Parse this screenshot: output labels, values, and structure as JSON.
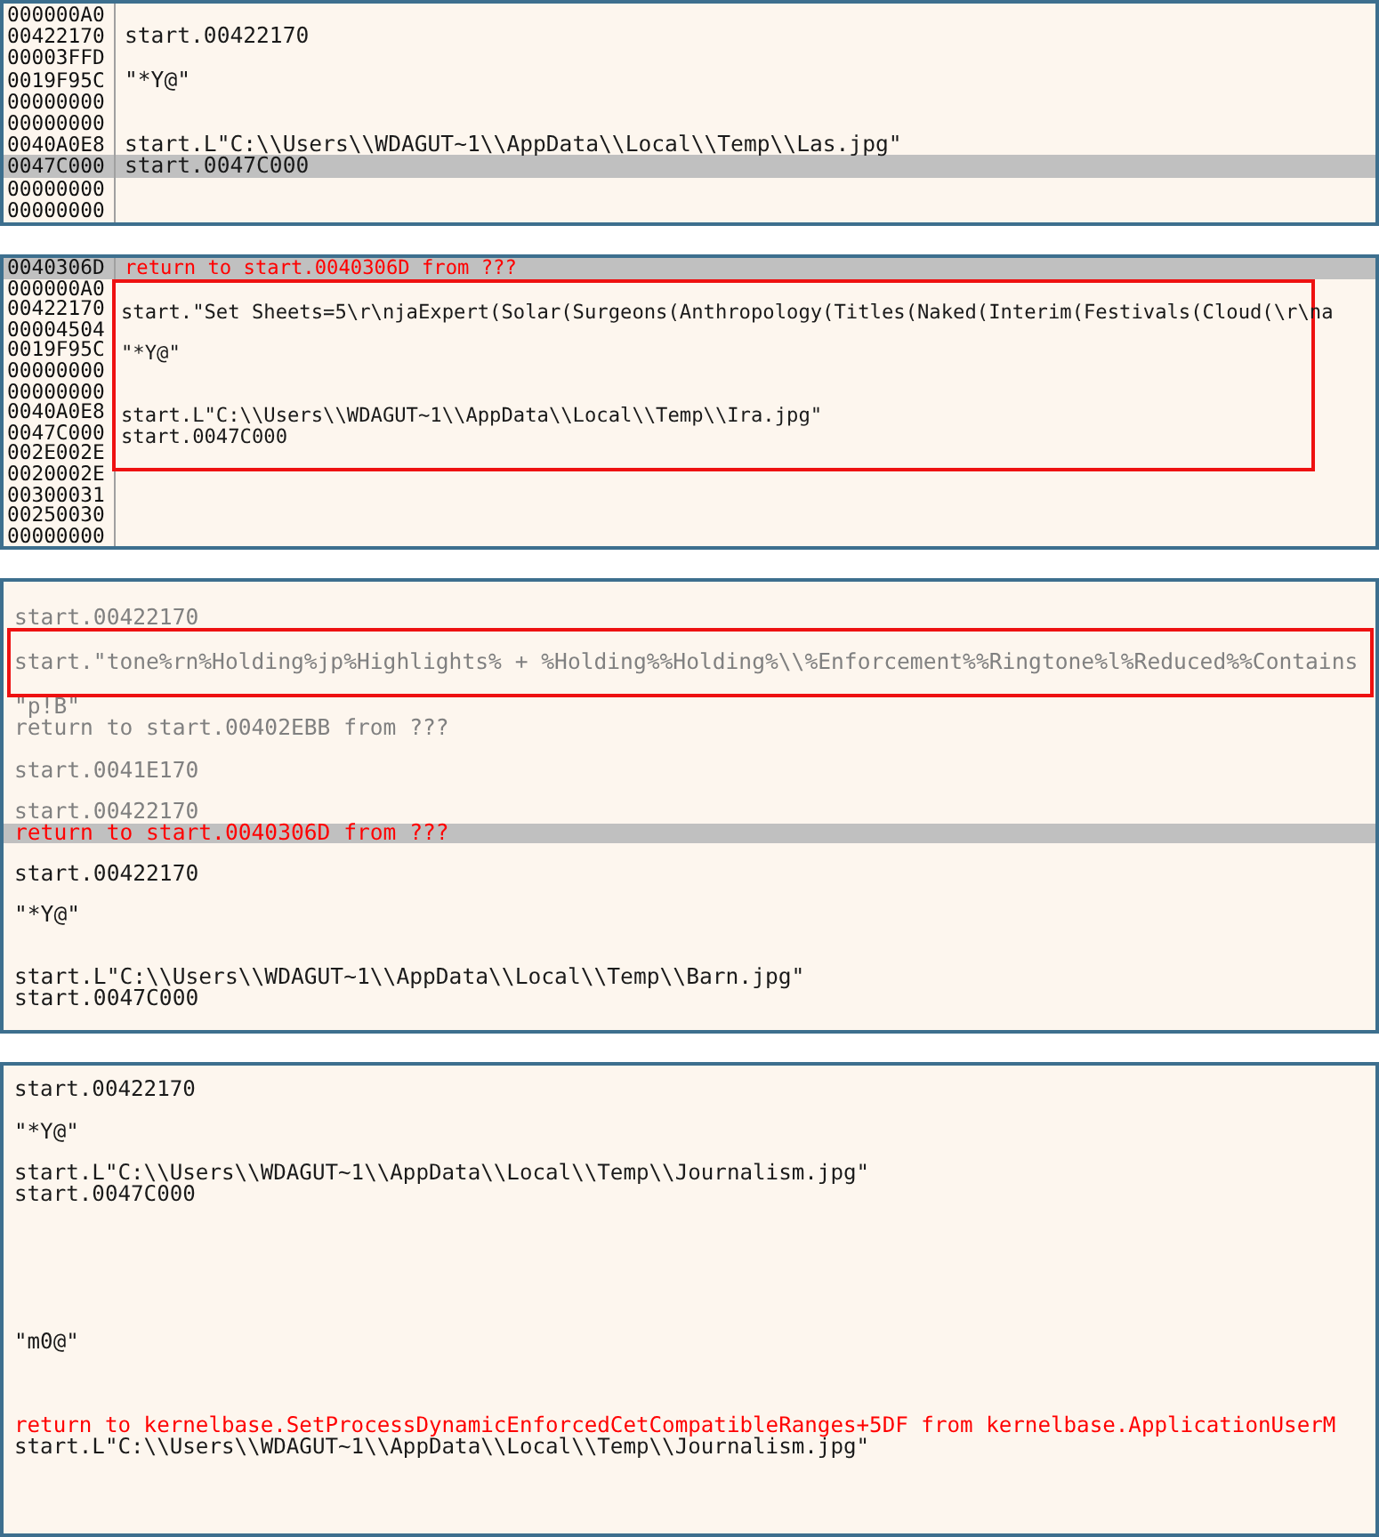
{
  "panels": [
    {
      "items": [
        {
          "address": "000000A0",
          "selected": false
        },
        {
          "address": "00422170",
          "text": "start.00422170",
          "kind": "code",
          "selected": false
        },
        {
          "address": "00003FFD",
          "selected": false
        },
        {
          "address": "0019F95C",
          "text": "\"*Y@\"",
          "kind": "code",
          "selected": false
        },
        {
          "address": "00000000",
          "selected": false
        },
        {
          "address": "00000000",
          "selected": false
        },
        {
          "address": "0040A0E8",
          "text": "start.L\"C:\\\\Users\\\\WDAGUT~1\\\\AppData\\\\Local\\\\Temp\\\\Las.jpg\"",
          "kind": "code",
          "selected": false
        },
        {
          "address": "0047C000",
          "text": "start.0047C000",
          "kind": "code",
          "selected": true
        },
        {
          "address": "00000000",
          "selected": false
        },
        {
          "address": "00000000",
          "selected": false
        }
      ]
    },
    {
      "items": [
        {
          "address": "0040306D",
          "text": "return to start.0040306D from ???",
          "kind": "return",
          "selected": true
        },
        {
          "kind": "frame",
          "rows": [
            {
              "address": "000000A0",
              "selected": false
            },
            {
              "address": "00422170",
              "text": "start.\"Set Sheets=5\\r\\njaExpert(Solar(Surgeons(Anthropology(Titles(Naked(Interim(Festivals(Cloud(\\r\\na",
              "kind": "code",
              "selected": false
            },
            {
              "address": "00004504",
              "selected": false
            },
            {
              "address": "0019F95C",
              "text": "\"*Y@\"",
              "kind": "code",
              "selected": false
            },
            {
              "address": "00000000",
              "selected": false
            },
            {
              "address": "00000000",
              "selected": false
            },
            {
              "address": "0040A0E8",
              "text": "start.L\"C:\\\\Users\\\\WDAGUT~1\\\\AppData\\\\Local\\\\Temp\\\\Ira.jpg\"",
              "kind": "code",
              "selected": false
            },
            {
              "address": "0047C000",
              "text": "start.0047C000",
              "kind": "code",
              "selected": false
            },
            {
              "address": "002E002E",
              "selected": false
            }
          ]
        },
        {
          "address": "0020002E",
          "selected": false
        },
        {
          "address": "00300031",
          "selected": false
        },
        {
          "address": "00250030",
          "selected": false
        },
        {
          "address": "00000000",
          "selected": false
        }
      ]
    },
    {
      "items": [
        {
          "selected": false
        },
        {
          "text": "start.00422170",
          "kind": "dim",
          "selected": false
        },
        {
          "kind": "frame",
          "rows": [
            {
              "selected": false
            },
            {
              "text": "start.\"tone%rn%Holding%jp%Highlights% + %Holding%%Holding%\\\\%Enforcement%%Ringtone%l%Reduced%%Contains",
              "kind": "dim",
              "selected": false
            },
            {
              "selected": false
            }
          ]
        },
        {
          "text": "\"p!B\"",
          "kind": "dim",
          "selected": false
        },
        {
          "text": "return to start.00402EBB from ???",
          "kind": "dim",
          "selected": false
        },
        {
          "selected": false
        },
        {
          "text": "start.0041E170",
          "kind": "dim",
          "selected": false
        },
        {
          "selected": false
        },
        {
          "text": "start.00422170",
          "kind": "dim",
          "selected": false
        },
        {
          "text": "return to start.0040306D from ???",
          "kind": "return",
          "selected": true
        },
        {
          "selected": false
        },
        {
          "text": "start.00422170",
          "kind": "code",
          "selected": false
        },
        {
          "selected": false
        },
        {
          "text": "\"*Y@\"",
          "kind": "code",
          "selected": false
        },
        {
          "selected": false
        },
        {
          "selected": false
        },
        {
          "text": "start.L\"C:\\\\Users\\\\WDAGUT~1\\\\AppData\\\\Local\\\\Temp\\\\Barn.jpg\"",
          "kind": "code",
          "selected": false
        },
        {
          "text": "start.0047C000",
          "kind": "code",
          "selected": false
        }
      ]
    },
    {
      "items": [
        {
          "text": "start.00422170",
          "kind": "code",
          "selected": false
        },
        {
          "selected": false
        },
        {
          "text": "\"*Y@\"",
          "kind": "code",
          "selected": false
        },
        {
          "selected": false
        },
        {
          "text": "start.L\"C:\\\\Users\\\\WDAGUT~1\\\\AppData\\\\Local\\\\Temp\\\\Journalism.jpg\"",
          "kind": "code",
          "selected": false
        },
        {
          "text": "start.0047C000",
          "kind": "code",
          "selected": false
        },
        {
          "selected": false
        },
        {
          "selected": false
        },
        {
          "selected": false
        },
        {
          "selected": false
        },
        {
          "selected": false
        },
        {
          "selected": false
        },
        {
          "text": "\"m0@\"",
          "kind": "code",
          "selected": false
        },
        {
          "selected": false
        },
        {
          "selected": false
        },
        {
          "selected": false
        },
        {
          "text": "return to kernelbase.SetProcessDynamicEnforcedCetCompatibleRanges+5DF from kernelbase.ApplicationUserM",
          "kind": "return",
          "selected": false
        },
        {
          "text": "start.L\"C:\\\\Users\\\\WDAGUT~1\\\\AppData\\\\Local\\\\Temp\\\\Journalism.jpg\"",
          "kind": "code",
          "selected": false
        }
      ]
    }
  ]
}
